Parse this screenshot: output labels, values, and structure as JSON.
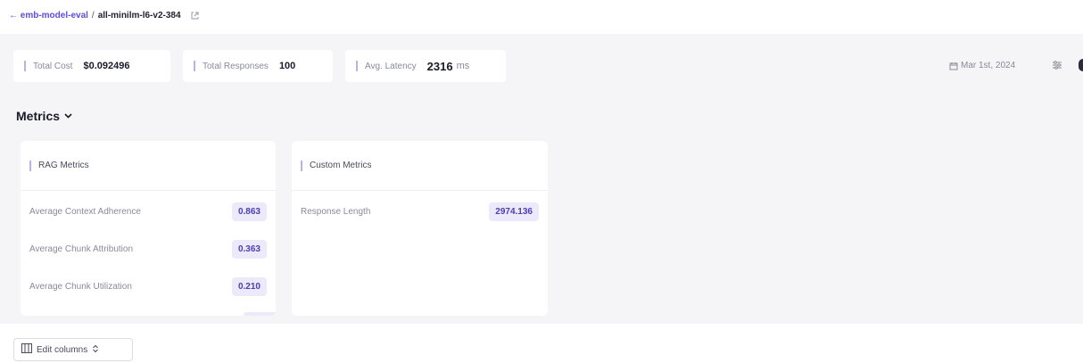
{
  "breadcrumb": {
    "back_label": "← emb-model-eval",
    "separator": "/",
    "current": "all-minilm-l6-v2-384"
  },
  "stats": {
    "total_cost": {
      "label": "Total Cost",
      "value": "$0.092496"
    },
    "total_responses": {
      "label": "Total Responses",
      "value": "100"
    },
    "avg_latency": {
      "label": "Avg. Latency",
      "value": "2316",
      "unit": "ms"
    }
  },
  "date": {
    "label": "Mar 1st, 2024"
  },
  "metrics": {
    "title": "Metrics",
    "rag": {
      "title": "RAG Metrics",
      "rows": [
        {
          "label": "Average Context Adherence",
          "value": "0.863"
        },
        {
          "label": "Average Chunk Attribution",
          "value": "0.363"
        },
        {
          "label": "Average Chunk Utilization",
          "value": "0.210"
        }
      ]
    },
    "custom": {
      "title": "Custom Metrics",
      "rows": [
        {
          "label": "Response Length",
          "value": "2974.136"
        }
      ]
    }
  },
  "edit_columns": {
    "label": "Edit columns"
  },
  "icons": {
    "external_link": "external-link-icon",
    "calendar": "calendar-icon",
    "filter": "filter-icon",
    "chevron": "chevron-down-icon",
    "columns": "columns-icon",
    "sort": "sort-icon"
  },
  "colors": {
    "accent": "#5b4fd6",
    "pill_bg": "#ece9fb",
    "pill_text": "#4a3fb3",
    "panel_bg": "#f5f5f7"
  }
}
